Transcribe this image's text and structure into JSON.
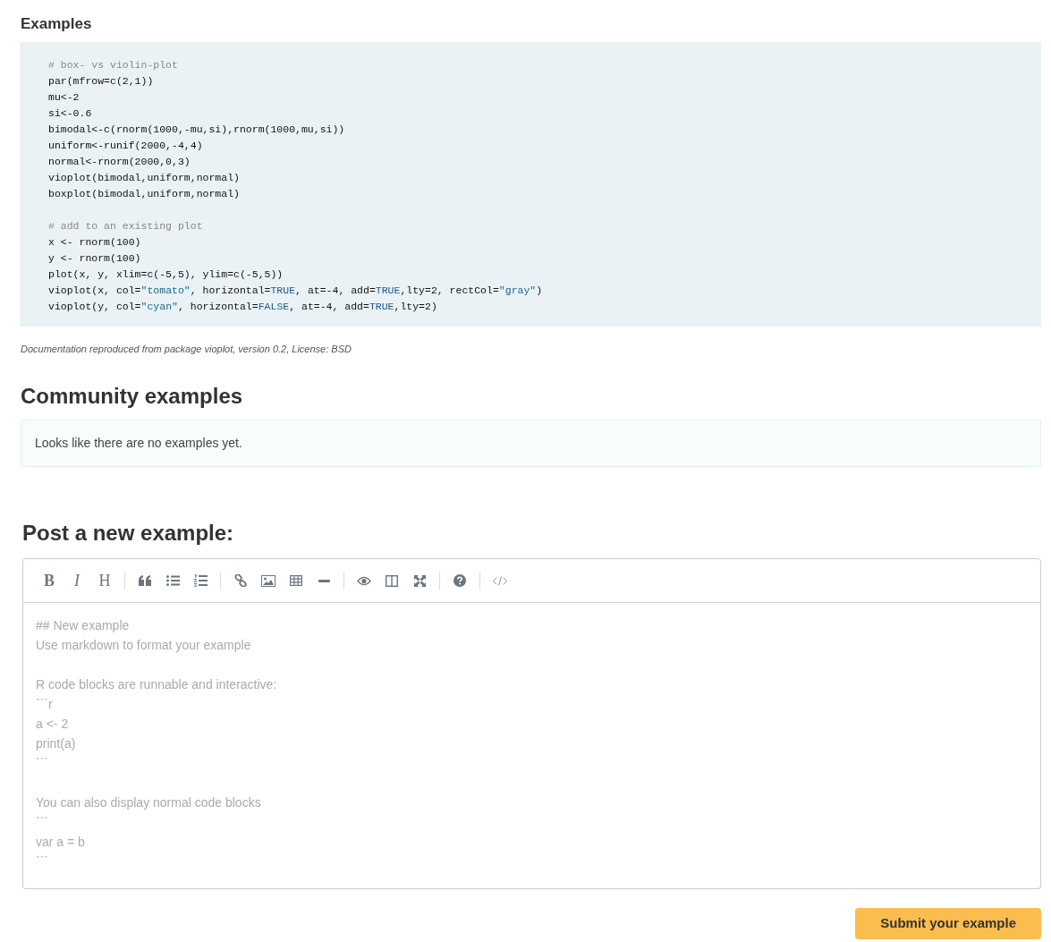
{
  "examples": {
    "heading": "Examples",
    "code": [
      [
        {
          "kind": "comment",
          "text": "# box- vs violin-plot"
        }
      ],
      [
        {
          "kind": "plain",
          "text": "par(mfrow=c(2,1))"
        }
      ],
      [
        {
          "kind": "plain",
          "text": "mu<-2"
        }
      ],
      [
        {
          "kind": "plain",
          "text": "si<-0.6"
        }
      ],
      [
        {
          "kind": "plain",
          "text": "bimodal<-c(rnorm(1000,-mu,si),rnorm(1000,mu,si))"
        }
      ],
      [
        {
          "kind": "plain",
          "text": "uniform<-runif(2000,-4,4)"
        }
      ],
      [
        {
          "kind": "plain",
          "text": "normal<-rnorm(2000,0,3)"
        }
      ],
      [
        {
          "kind": "plain",
          "text": "vioplot(bimodal,uniform,normal)"
        }
      ],
      [
        {
          "kind": "plain",
          "text": "boxplot(bimodal,uniform,normal)"
        }
      ],
      {
        "kind": "blank"
      },
      [
        {
          "kind": "comment",
          "text": "# add to an existing plot"
        }
      ],
      [
        {
          "kind": "plain",
          "text": "x <- rnorm(100)"
        }
      ],
      [
        {
          "kind": "plain",
          "text": "y <- rnorm(100)"
        }
      ],
      [
        {
          "kind": "plain",
          "text": "plot(x, y, xlim=c(-5,5), ylim=c(-5,5))"
        }
      ],
      [
        {
          "kind": "plain",
          "text": "vioplot(x, col="
        },
        {
          "kind": "string",
          "text": "\"tomato\""
        },
        {
          "kind": "plain",
          "text": ", horizontal="
        },
        {
          "kind": "literal",
          "text": "TRUE"
        },
        {
          "kind": "plain",
          "text": ", at=-4, add="
        },
        {
          "kind": "literal",
          "text": "TRUE"
        },
        {
          "kind": "plain",
          "text": ",lty=2, rectCol="
        },
        {
          "kind": "string",
          "text": "\"gray\""
        },
        {
          "kind": "plain",
          "text": ")"
        }
      ],
      [
        {
          "kind": "plain",
          "text": "vioplot(y, col="
        },
        {
          "kind": "string",
          "text": "\"cyan\""
        },
        {
          "kind": "plain",
          "text": ", horizontal="
        },
        {
          "kind": "literal",
          "text": "FALSE"
        },
        {
          "kind": "plain",
          "text": ", at=-4, add="
        },
        {
          "kind": "literal",
          "text": "TRUE"
        },
        {
          "kind": "plain",
          "text": ",lty=2)"
        }
      ]
    ],
    "caption": "Documentation reproduced from package vioplot, version 0.2, License: BSD"
  },
  "community": {
    "heading": "Community examples",
    "empty_message": "Looks like there are no examples yet."
  },
  "post": {
    "heading": "Post a new example:",
    "toolbar": [
      [
        {
          "kind": "bold",
          "label": "B"
        },
        {
          "kind": "italic",
          "label": "I"
        },
        {
          "kind": "heading",
          "label": "H"
        }
      ],
      [
        {
          "kind": "quote"
        },
        {
          "kind": "bullets"
        },
        {
          "kind": "numbers"
        }
      ],
      [
        {
          "kind": "link"
        },
        {
          "kind": "image"
        },
        {
          "kind": "table"
        },
        {
          "kind": "rule"
        }
      ],
      [
        {
          "kind": "preview"
        },
        {
          "kind": "side"
        },
        {
          "kind": "fullscreen"
        }
      ],
      [
        {
          "kind": "help"
        }
      ],
      [
        {
          "kind": "code"
        }
      ]
    ],
    "placeholder": "## New example\nUse markdown to format your example\n\nR code blocks are runnable and interactive:\n```r\na <- 2\nprint(a)\n```\n\nYou can also display normal code blocks\n```\nvar a = b\n```",
    "submit": "Submit your example"
  }
}
